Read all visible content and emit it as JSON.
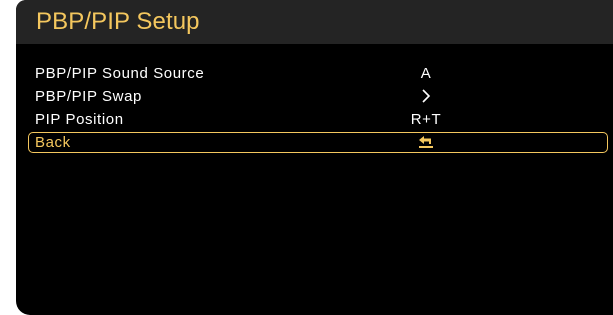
{
  "osd": {
    "title": "PBP/PIP Setup",
    "accent_color": "#f4c75e",
    "items": [
      {
        "label": "PBP/PIP Sound Source",
        "value": "A",
        "icon": null,
        "selected": false
      },
      {
        "label": "PBP/PIP Swap",
        "value": "",
        "icon": "chevron-right-icon",
        "selected": false
      },
      {
        "label": "PIP Position",
        "value": "R+T",
        "icon": null,
        "selected": false
      },
      {
        "label": "Back",
        "value": "",
        "icon": "return-arrow-icon",
        "selected": true
      }
    ]
  }
}
